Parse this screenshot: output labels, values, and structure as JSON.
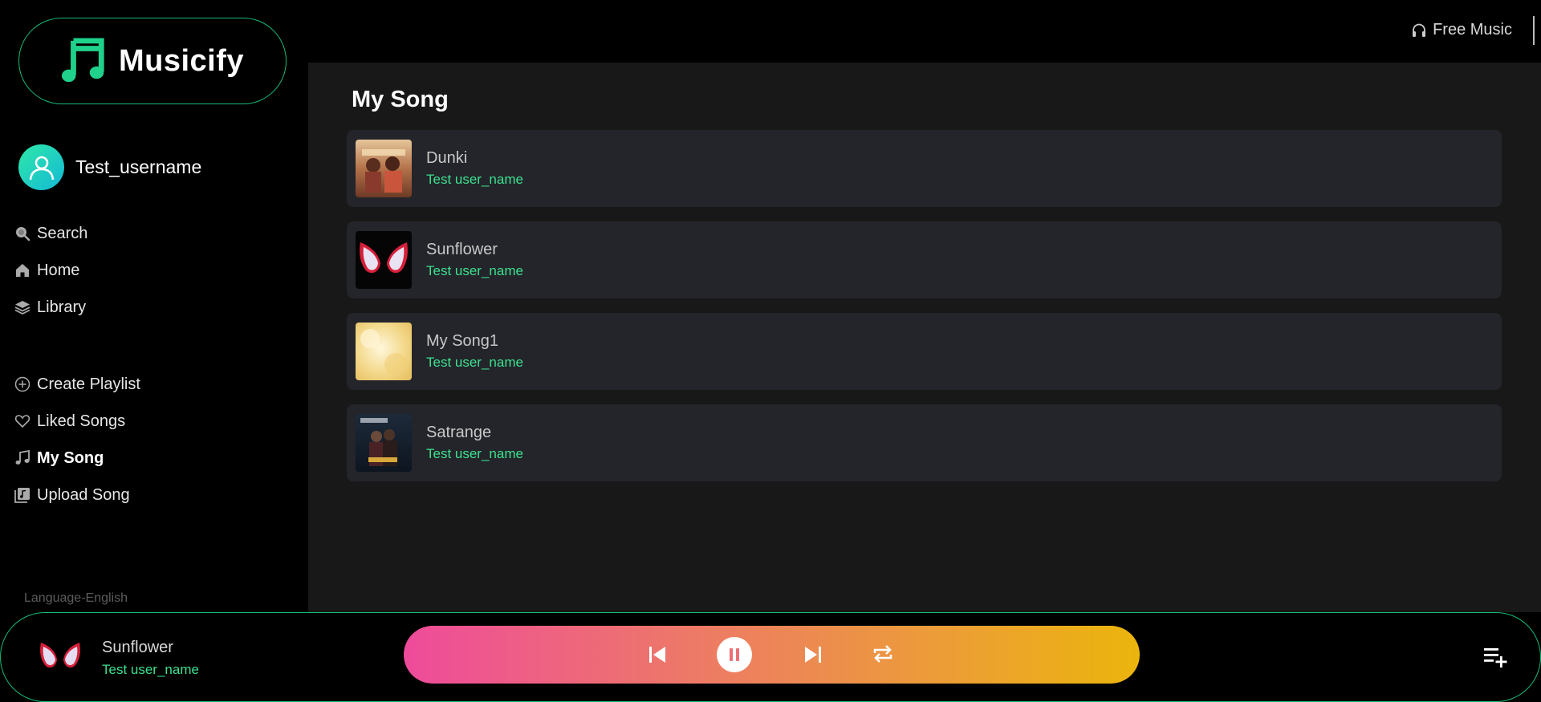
{
  "app": {
    "name": "Musicify"
  },
  "colors": {
    "accent": "#17b978",
    "artist_text": "#3ee08f",
    "gradient_start": "#ee4b9b",
    "gradient_end": "#ebb50c"
  },
  "user": {
    "username": "Test_username"
  },
  "sidebar": {
    "main_nav": [
      {
        "label": "Search",
        "icon": "search-icon"
      },
      {
        "label": "Home",
        "icon": "home-icon"
      },
      {
        "label": "Library",
        "icon": "layers-icon"
      }
    ],
    "secondary_nav": [
      {
        "label": "Create Playlist",
        "icon": "plus-circle-icon"
      },
      {
        "label": "Liked Songs",
        "icon": "heart-icon"
      },
      {
        "label": "My Song",
        "icon": "music-note-icon",
        "active": true
      },
      {
        "label": "Upload Song",
        "icon": "upload-music-icon"
      }
    ],
    "language": "Language-English"
  },
  "topbar": {
    "label": "Free Music",
    "icon": "headphones-icon"
  },
  "main": {
    "title": "My Song",
    "songs": [
      {
        "title": "Dunki",
        "artist": "Test user_name",
        "cover": "dunki-cover"
      },
      {
        "title": "Sunflower",
        "artist": "Test user_name",
        "cover": "spider-mask-cover"
      },
      {
        "title": "My Song1",
        "artist": "Test user_name",
        "cover": "yellow-abstract-cover"
      },
      {
        "title": "Satrange",
        "artist": "Test user_name",
        "cover": "animal-cover"
      }
    ]
  },
  "player": {
    "now_playing": {
      "title": "Sunflower",
      "artist": "Test user_name"
    },
    "state": "playing",
    "controls": [
      "previous-icon",
      "pause-icon",
      "next-icon",
      "repeat-icon"
    ],
    "queue_icon": "add-to-queue-icon"
  }
}
